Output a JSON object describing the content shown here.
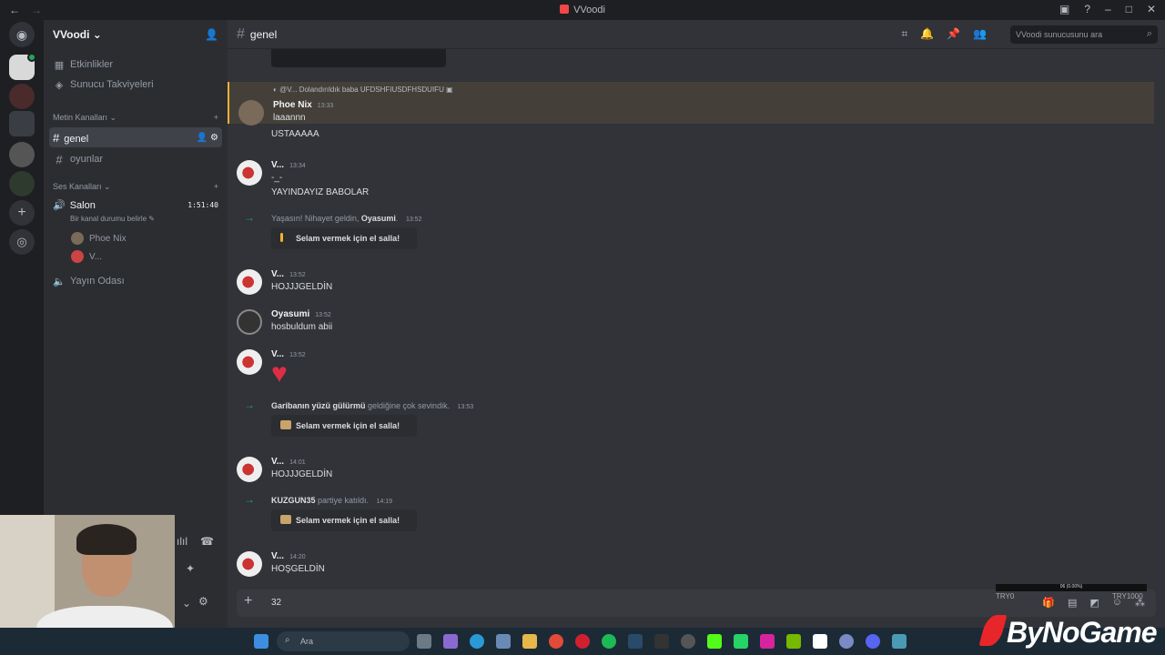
{
  "window": {
    "title": "VVoodi"
  },
  "server": {
    "name": "VVoodi"
  },
  "sidebar": {
    "top_items": [
      {
        "label": "Etkinlikler",
        "icon": "calendar-icon"
      },
      {
        "label": "Sunucu Takviyeleri",
        "icon": "boost-icon"
      }
    ],
    "text_category": "Metin Kanalları",
    "text_channels": [
      {
        "name": "genel",
        "active": true
      },
      {
        "name": "oyunlar",
        "active": false
      }
    ],
    "voice_category": "Ses Kanalları",
    "voice_channels": [
      {
        "name": "Salon",
        "timer": "1:51:40",
        "status_hint": "Bir kanal durumu belirle",
        "users": [
          {
            "name": "Phoe Nix"
          },
          {
            "name": "V..."
          }
        ]
      },
      {
        "name": "Yayın Odası"
      }
    ]
  },
  "channel_header": {
    "name": "genel",
    "search_placeholder": "VVoodi sunucusunu ara"
  },
  "messages": [
    {
      "type": "reply",
      "reply_to": "@V... Dolandırıldık baba UFDSHFIUSDFHSDUIFU",
      "author": "Phoe Nix",
      "time": "13:33",
      "lines": [
        "laaannn",
        "USTAAAAA"
      ]
    },
    {
      "type": "msg",
      "author": "V...",
      "time": "13:34",
      "lines": [
        "-_-",
        "YAYINDAYIZ BABOLAR"
      ]
    },
    {
      "type": "join",
      "prefix": "Yaşasın! Nihayet geldin, ",
      "user": "Oyasumi",
      "suffix": ".",
      "time": "13:52",
      "button": "Selam vermek için el salla!"
    },
    {
      "type": "msg",
      "author": "V...",
      "time": "13:52",
      "lines": [
        "HOJJJGELDİN"
      ]
    },
    {
      "type": "msg",
      "author": "Oyasumi",
      "time": "13:52",
      "lines": [
        "hosbuldum abii"
      ]
    },
    {
      "type": "msg",
      "author": "V...",
      "time": "13:52",
      "lines": [
        "♥"
      ]
    },
    {
      "type": "join",
      "prefix": "",
      "user": "Garibanın yüzü gülürmü",
      "suffix": " geldiğine çok sevindik.",
      "time": "13:53",
      "button": "Selam vermek için el salla!"
    },
    {
      "type": "msg",
      "author": "V...",
      "time": "14:01",
      "lines": [
        "HOJJJGELDİN"
      ]
    },
    {
      "type": "join",
      "prefix": "",
      "user": "KUZGUN35",
      "suffix": " partiye katıldı.",
      "time": "14:19",
      "button": "Selam vermek için el salla!"
    },
    {
      "type": "msg",
      "author": "V...",
      "time": "14:20",
      "lines": [
        "HOŞGELDİN"
      ]
    }
  ],
  "composer": {
    "value": "32"
  },
  "overlay": {
    "bar_text": "06 (0.00%)",
    "min": "TRY0",
    "max": "TRY1000"
  },
  "taskbar": {
    "search_placeholder": "Ara"
  },
  "brand": {
    "name": "ByNoGame"
  }
}
